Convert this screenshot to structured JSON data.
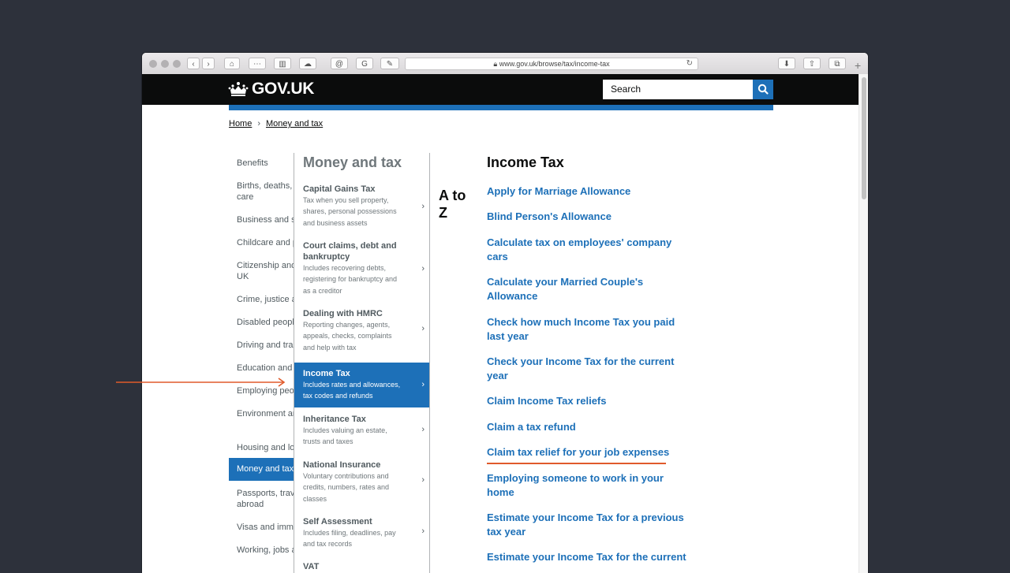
{
  "browser": {
    "url": "www.gov.uk/browse/tax/income-tax",
    "nav_icons": [
      "back-icon",
      "forward-icon",
      "home-icon",
      "grid-icon",
      "sidebar-icon",
      "cloud-icon",
      "at-icon",
      "grammarly-icon",
      "pin-icon"
    ],
    "right_icons": [
      "download-icon",
      "share-icon",
      "tabs-icon"
    ]
  },
  "header": {
    "logo_text": "GOV.UK",
    "search_placeholder": "Search"
  },
  "breadcrumb": [
    "Home",
    "Money and tax"
  ],
  "col1": {
    "items": [
      "Benefits",
      "Births, deaths, marriages and care",
      "Business and self-employed",
      "Childcare and parenting",
      "Citizenship and living in the UK",
      "Crime, justice and the law",
      "Disabled people",
      "Driving and transport",
      "Education and learning",
      "Employing people",
      "Environment and countryside",
      "Housing and local services",
      "Money and tax",
      "Passports, travel and living abroad",
      "Visas and immigration",
      "Working, jobs and pensions"
    ],
    "active_index": 12
  },
  "col2": {
    "title": "Money and tax",
    "items": [
      {
        "title": "Capital Gains Tax",
        "desc": [
          "Tax when you sell property,",
          "shares, personal possessions",
          "and business assets"
        ]
      },
      {
        "title": [
          "Court claims, debt and",
          "bankruptcy"
        ],
        "desc": [
          "Includes recovering debts,",
          "registering for bankruptcy and",
          "as a creditor"
        ]
      },
      {
        "title": "Dealing with HMRC",
        "desc": [
          "Reporting changes, agents,",
          "appeals, checks, complaints",
          "and help with tax"
        ]
      },
      {
        "title": "Income Tax",
        "desc": [
          "Includes rates and allowances,",
          "tax codes and refunds"
        ]
      },
      {
        "title": "Inheritance Tax",
        "desc": [
          "Includes valuing an estate,",
          "trusts and taxes"
        ]
      },
      {
        "title": "National Insurance",
        "desc": [
          "Voluntary contributions and",
          "credits, numbers, rates and",
          "classes"
        ]
      },
      {
        "title": "Self Assessment",
        "desc": [
          "Includes filing, deadlines, pay",
          "and tax records"
        ]
      },
      {
        "title": "VAT",
        "desc": []
      }
    ],
    "active_index": 3
  },
  "atoz": [
    "A to",
    "Z"
  ],
  "col3": {
    "title": "Income Tax",
    "links": [
      [
        "Apply for Marriage Allowance"
      ],
      [
        "Blind Person's Allowance"
      ],
      [
        "Calculate tax on employees' company",
        "cars"
      ],
      [
        "Calculate your Married Couple's",
        "Allowance"
      ],
      [
        "Check how much Income Tax you paid",
        "last year"
      ],
      [
        "Check your Income Tax for the current",
        "year"
      ],
      [
        "Claim Income Tax reliefs"
      ],
      [
        "Claim a tax refund"
      ],
      [
        "Claim tax relief for your job expenses"
      ],
      [
        "Employing someone to work in your",
        "home"
      ],
      [
        "Estimate your Income Tax for a previous",
        "tax year"
      ],
      [
        "Estimate your Income Tax for the current"
      ]
    ]
  },
  "colors": {
    "accent": "#1d70b8",
    "highlight": "#e05a2b",
    "header": "#0b0c0c",
    "background": "#2d313b"
  }
}
